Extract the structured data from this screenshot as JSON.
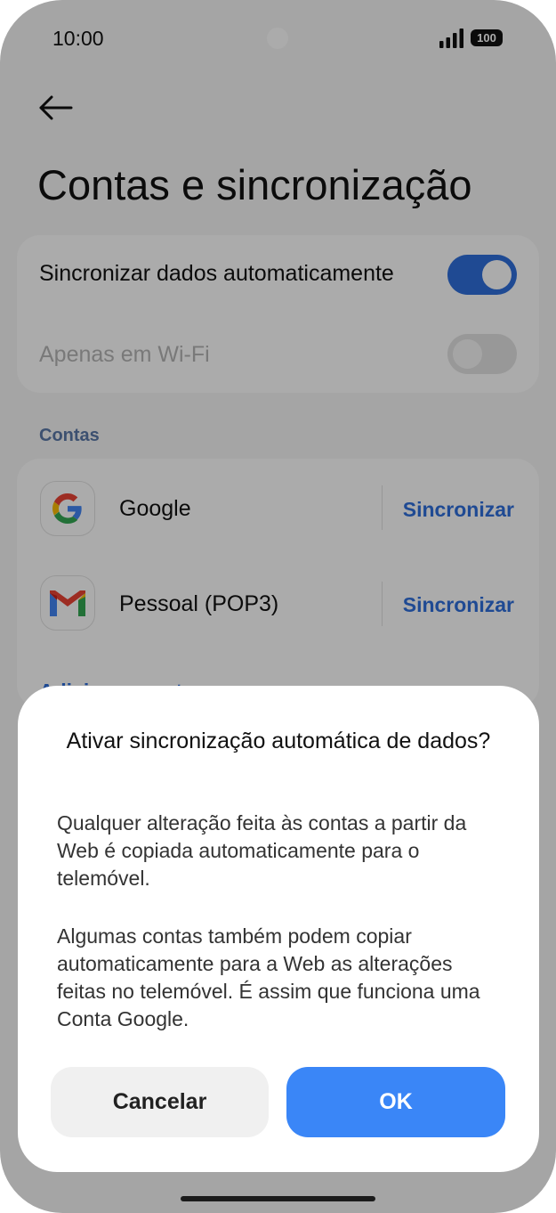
{
  "status_bar": {
    "time": "10:00",
    "battery": "100"
  },
  "page": {
    "title": "Contas e sincronização"
  },
  "settings": {
    "auto_sync_label": "Sincronizar dados automaticamente",
    "wifi_only_label": "Apenas em Wi-Fi"
  },
  "accounts": {
    "section_label": "Contas",
    "items": [
      {
        "name": "Google",
        "action": "Sincronizar"
      },
      {
        "name": "Pessoal (POP3)",
        "action": "Sincronizar"
      }
    ],
    "add_label": "Adicionar conta"
  },
  "dialog": {
    "title": "Ativar sincronização automática de dados?",
    "paragraph1": "Qualquer alteração feita às contas a partir da Web é copiada automaticamente para o telemóvel.",
    "paragraph2": "Algumas contas também podem copiar automaticamente para a Web as alterações feitas no telemóvel. É assim que funciona uma Conta Google.",
    "cancel_label": "Cancelar",
    "ok_label": "OK"
  },
  "colors": {
    "accent": "#2f6fdc",
    "ok_button": "#3a86f7",
    "section_label": "#5a78a8"
  },
  "icons": {
    "back": "arrow-left-icon",
    "google": "google-logo-icon",
    "gmail": "gmail-logo-icon"
  }
}
